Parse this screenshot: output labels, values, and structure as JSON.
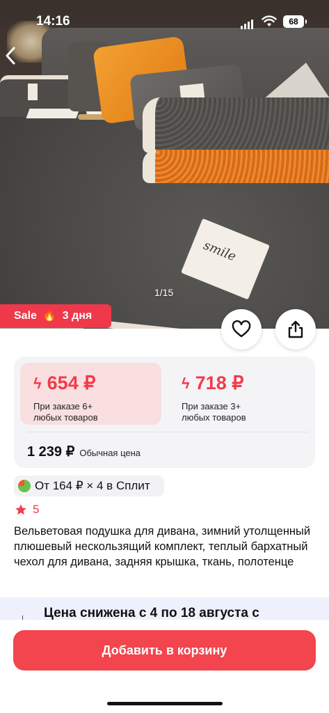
{
  "status_bar": {
    "time": "14:16",
    "battery": "68"
  },
  "gallery": {
    "counter": "1/15",
    "label_text": "smile"
  },
  "sale_badge": {
    "label": "Sale",
    "emoji": "🔥",
    "days": "3 дня"
  },
  "prices": {
    "tier1": {
      "amount": "654 ₽",
      "note_line1": "При заказе 6+",
      "note_line2": "любых товаров"
    },
    "tier2": {
      "amount": "718 ₽",
      "note_line1": "При заказе 3+",
      "note_line2": "любых товаров"
    },
    "regular_value": "1 239 ₽",
    "regular_label": "Обычная цена"
  },
  "split": {
    "text": "От 164 ₽ × 4 в Сплит"
  },
  "rating": {
    "value": "5"
  },
  "product": {
    "title": "Вельветовая подушка для дивана, зимний утолщенный плюшевый нескользящий комплект, теплый бархатный чехол для дивана, задняя крышка, ткань, полотенце"
  },
  "promo": {
    "text": "Цена снижена с 4 по 18 августа с"
  },
  "actions": {
    "add_to_cart": "Добавить в корзину"
  },
  "colors": {
    "accent": "#f23b4c",
    "sale_bg": "#f0384b",
    "cart_button": "#f2454d",
    "tier_highlight": "#f9dfe0"
  },
  "icons": [
    "back-icon",
    "heart-icon",
    "share-icon",
    "bolt-icon",
    "star-icon",
    "split-icon",
    "fire-icon"
  ]
}
